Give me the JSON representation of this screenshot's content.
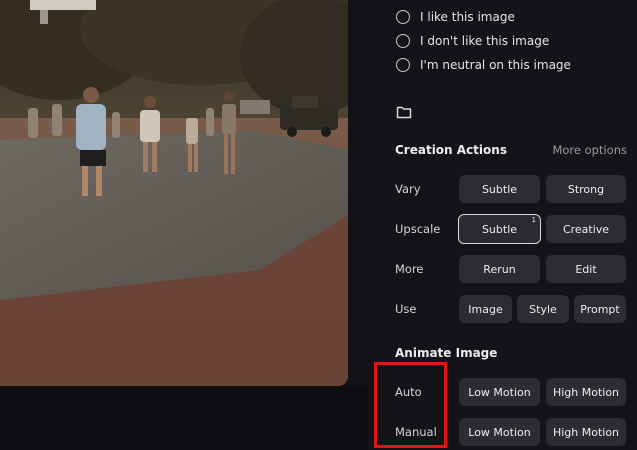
{
  "photo": {
    "alt": "basketball court photo"
  },
  "feedback": {
    "options": [
      {
        "label": "I like this image"
      },
      {
        "label": "I don't like this image"
      },
      {
        "label": "I'm neutral on this image"
      }
    ]
  },
  "creation": {
    "title": "Creation Actions",
    "more_options": "More options",
    "vary": {
      "label": "Vary",
      "subtle": "Subtle",
      "strong": "Strong"
    },
    "upscale": {
      "label": "Upscale",
      "subtle": "Subtle",
      "subtle_badge": "1",
      "creative": "Creative"
    },
    "more": {
      "label": "More",
      "rerun": "Rerun",
      "edit": "Edit"
    },
    "use": {
      "label": "Use",
      "image": "Image",
      "style": "Style",
      "prompt": "Prompt"
    }
  },
  "animate": {
    "title": "Animate Image",
    "auto": {
      "label": "Auto",
      "low": "Low Motion",
      "high": "High Motion"
    },
    "manual": {
      "label": "Manual",
      "low": "Low Motion",
      "high": "High Motion"
    }
  },
  "colors": {
    "highlight": "#e01515",
    "panel_bg": "#141418",
    "button_bg": "#2c2c33"
  }
}
